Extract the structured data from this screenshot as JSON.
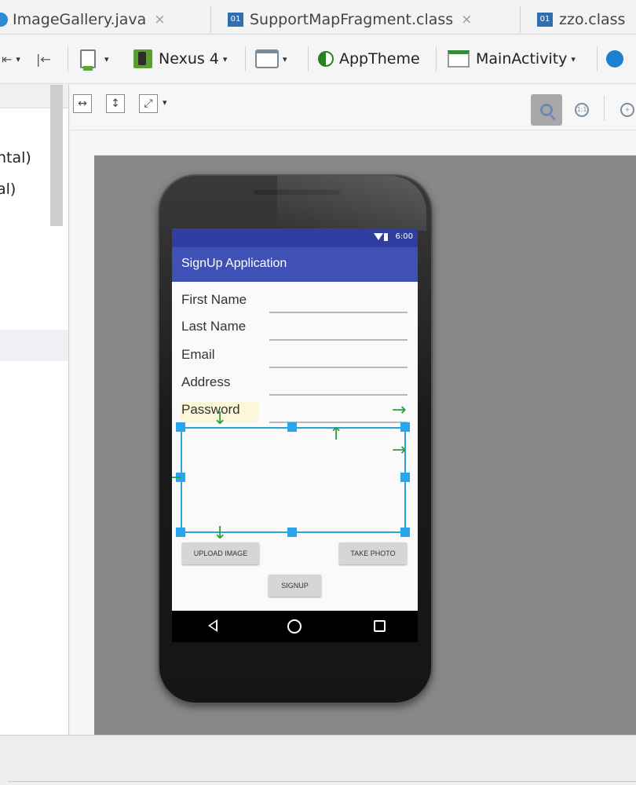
{
  "tabs": [
    {
      "label": "ImageGallery.java",
      "icon": "java-file-icon",
      "close": "×"
    },
    {
      "label": "SupportMapFragment.class",
      "icon": "class-file-icon",
      "close": "×"
    },
    {
      "label": "zzo.class",
      "icon": "class-file-icon"
    }
  ],
  "toolbar": {
    "device": "Nexus 4",
    "theme": "AppTheme",
    "activity": "MainActivity",
    "theme_accent": "#2a7f27"
  },
  "left_panel": {
    "items": [
      "ntal)",
      "al)"
    ]
  },
  "phone": {
    "status_time": "6:00",
    "app_title": "SignUp Application",
    "statusbar_color": "#303f9f",
    "appbar_color": "#3f51b5",
    "fields": [
      {
        "label": "First Name"
      },
      {
        "label": "Last Name"
      },
      {
        "label": "Email"
      },
      {
        "label": "Address"
      },
      {
        "label": "Password"
      }
    ],
    "buttons": {
      "upload": "UPLOAD IMAGE",
      "take_photo": "TAKE PHOTO",
      "signup": "SIGNUP"
    },
    "selection_color": "#29a3e0"
  }
}
